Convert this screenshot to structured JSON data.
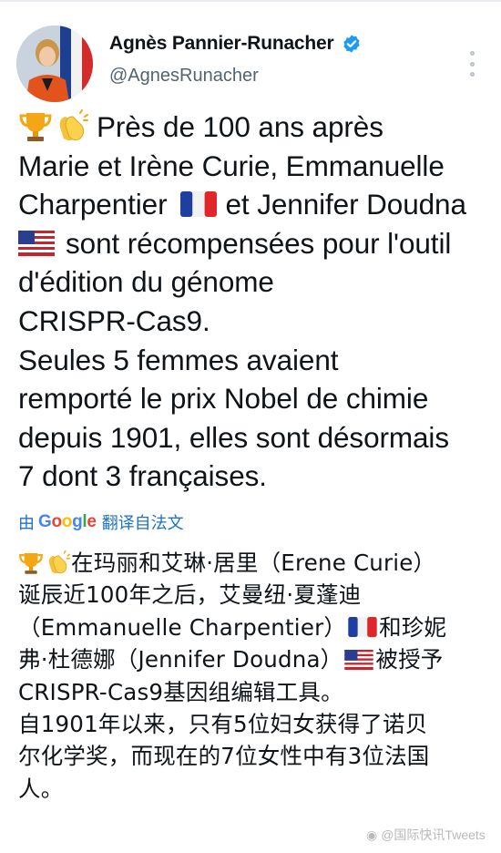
{
  "author": {
    "name": "Agnès Pannier-Runacher",
    "handle": "@AgnesRunacher"
  },
  "icons": {
    "verified": "verified-badge-icon",
    "more": "more-options-icon",
    "trophy": "trophy-emoji",
    "clap": "clapping-hands-emoji",
    "flag_fr": "flag-france-emoji",
    "flag_us": "flag-usa-emoji"
  },
  "tweet": {
    "line1": "Près de 100 ans après",
    "line2": "Marie et Irène Curie, Emmanuelle",
    "line3a": "Charpentier",
    "line3b": "et Jennifer Doudna",
    "line4": "sont récompensées pour l'outil",
    "line5": "d'édition du génome",
    "line6": "CRISPR-Cas9.",
    "line7": "Seules 5 femmes avaient",
    "line8": "remporté le prix Nobel de chimie",
    "line9": "depuis 1901, elles sont désormais",
    "line10": "7 dont 3 françaises."
  },
  "translate": {
    "by": "由",
    "google": "Google",
    "label": "翻译自法文"
  },
  "translation": {
    "line1": "在玛丽和艾琳·居里（Erene Curie）",
    "line2": "诞辰近100年之后，艾曼纽·夏蓬迪",
    "line3a": "（Emmanuelle Charpentier）",
    "line3b": "和珍妮",
    "line4a": "弗·杜德娜（Jennifer Doudna）",
    "line4b": "被授予",
    "line5": "CRISPR-Cas9基因组编辑工具。",
    "line6": "自1901年以来，只有5位妇女获得了诺贝",
    "line7": "尔化学奖，而现在的7位女性中有3位法国",
    "line8": "人。"
  },
  "watermark": "@国际快讯Tweets",
  "colors": {
    "link_blue": "#1d72c8",
    "verified_blue": "#1d9bf0",
    "secondary_text": "#536471"
  }
}
